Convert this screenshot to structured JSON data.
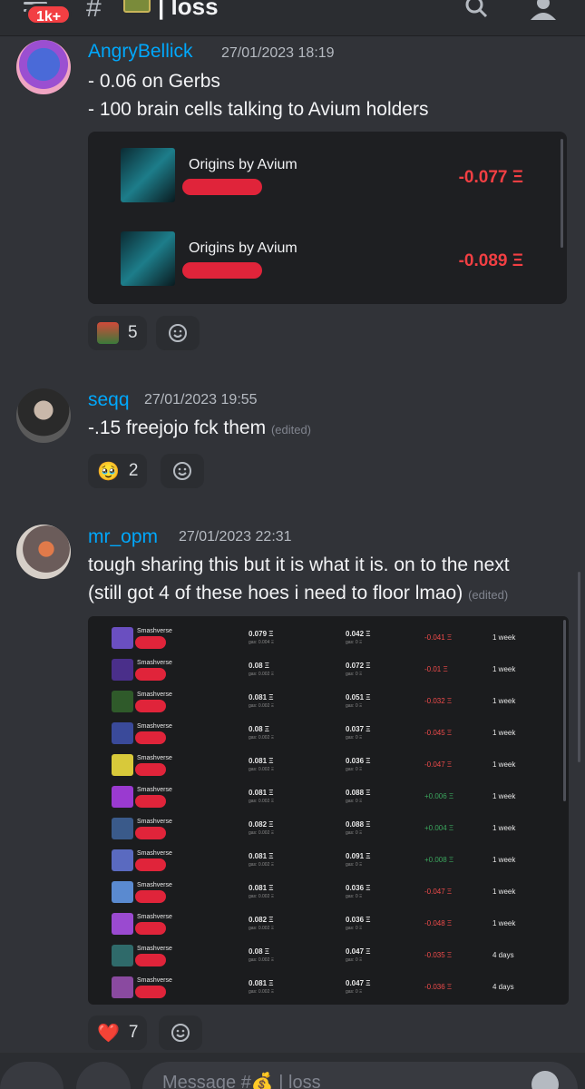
{
  "header": {
    "badge": "1k+",
    "hash": "#",
    "channel_emoji": "money-bag-emoji",
    "channel_separator": "|",
    "channel_name": "loss",
    "icons": [
      "hamburger-menu-icon",
      "search-icon",
      "members-icon"
    ]
  },
  "messages": [
    {
      "username": "AngryBellick",
      "timestamp": "27/01/2023 18:19",
      "lines": [
        "- 0.06 on Gerbs",
        "- 100 brain cells talking to Avium holders"
      ],
      "embed": {
        "items": [
          {
            "title": "Origins by Avium",
            "value": "-0.077 Ξ"
          },
          {
            "title": "Origins by Avium",
            "value": "-0.089 Ξ"
          }
        ]
      },
      "reactions": [
        {
          "emoji": "pepe-sweat-emoji",
          "count": "5"
        }
      ]
    },
    {
      "username": "seqq",
      "timestamp": "27/01/2023 19:55",
      "lines": [
        "-.15 freejojo fck them"
      ],
      "edited": "(edited)",
      "reactions": [
        {
          "emoji": "🥹",
          "count": "2"
        }
      ]
    },
    {
      "username": "mr_opm",
      "timestamp": "27/01/2023 22:31",
      "lines": [
        "tough sharing this but it is what it is. on to the next",
        "(still got 4 of these hoes i need to floor lmao)"
      ],
      "edited": "(edited)",
      "table": {
        "rows": [
          {
            "name": "Smashverse",
            "buy": "0.079 Ξ",
            "buy_gas": "gas: 0.004 Ξ",
            "sell": "0.042 Ξ",
            "sell_gas": "gas: 0 Ξ",
            "diff": "-0.041 Ξ",
            "age": "1 week",
            "positive": false
          },
          {
            "name": "Smashverse",
            "buy": "0.08 Ξ",
            "buy_gas": "gas: 0.002 Ξ",
            "sell": "0.072 Ξ",
            "sell_gas": "gas: 0 Ξ",
            "diff": "-0.01 Ξ",
            "age": "1 week",
            "positive": false
          },
          {
            "name": "Smashverse",
            "buy": "0.081 Ξ",
            "buy_gas": "gas: 0.002 Ξ",
            "sell": "0.051 Ξ",
            "sell_gas": "gas: 0 Ξ",
            "diff": "-0.032 Ξ",
            "age": "1 week",
            "positive": false
          },
          {
            "name": "Smashverse",
            "buy": "0.08 Ξ",
            "buy_gas": "gas: 0.002 Ξ",
            "sell": "0.037 Ξ",
            "sell_gas": "gas: 0 Ξ",
            "diff": "-0.045 Ξ",
            "age": "1 week",
            "positive": false
          },
          {
            "name": "Smashverse",
            "buy": "0.081 Ξ",
            "buy_gas": "gas: 0.002 Ξ",
            "sell": "0.036 Ξ",
            "sell_gas": "gas: 0 Ξ",
            "diff": "-0.047 Ξ",
            "age": "1 week",
            "positive": false
          },
          {
            "name": "Smashverse",
            "buy": "0.081 Ξ",
            "buy_gas": "gas: 0.002 Ξ",
            "sell": "0.088 Ξ",
            "sell_gas": "gas: 0 Ξ",
            "diff": "+0.006 Ξ",
            "age": "1 week",
            "positive": true
          },
          {
            "name": "Smashverse",
            "buy": "0.082 Ξ",
            "buy_gas": "gas: 0.002 Ξ",
            "sell": "0.088 Ξ",
            "sell_gas": "gas: 0 Ξ",
            "diff": "+0.004 Ξ",
            "age": "1 week",
            "positive": true
          },
          {
            "name": "Smashverse",
            "buy": "0.081 Ξ",
            "buy_gas": "gas: 0.002 Ξ",
            "sell": "0.091 Ξ",
            "sell_gas": "gas: 0 Ξ",
            "diff": "+0.008 Ξ",
            "age": "1 week",
            "positive": true
          },
          {
            "name": "Smashverse",
            "buy": "0.081 Ξ",
            "buy_gas": "gas: 0.002 Ξ",
            "sell": "0.036 Ξ",
            "sell_gas": "gas: 0 Ξ",
            "diff": "-0.047 Ξ",
            "age": "1 week",
            "positive": false
          },
          {
            "name": "Smashverse",
            "buy": "0.082 Ξ",
            "buy_gas": "gas: 0.002 Ξ",
            "sell": "0.036 Ξ",
            "sell_gas": "gas: 0 Ξ",
            "diff": "-0.048 Ξ",
            "age": "1 week",
            "positive": false
          },
          {
            "name": "Smashverse",
            "buy": "0.08 Ξ",
            "buy_gas": "gas: 0.002 Ξ",
            "sell": "0.047 Ξ",
            "sell_gas": "gas: 0 Ξ",
            "diff": "-0.035 Ξ",
            "age": "4 days",
            "positive": false
          },
          {
            "name": "Smashverse",
            "buy": "0.081 Ξ",
            "buy_gas": "gas: 0.002 Ξ",
            "sell": "0.047 Ξ",
            "sell_gas": "gas: 0 Ξ",
            "diff": "-0.036 Ξ",
            "age": "4 days",
            "positive": false
          }
        ]
      },
      "reactions": [
        {
          "emoji": "❤️",
          "count": "7"
        }
      ]
    }
  ],
  "composer": {
    "placeholder": "Message #💰 | loss"
  },
  "colors": {
    "background": "#313338",
    "username": "#00a8fc",
    "negative": "#f23f43",
    "positive": "#3ba55d"
  }
}
